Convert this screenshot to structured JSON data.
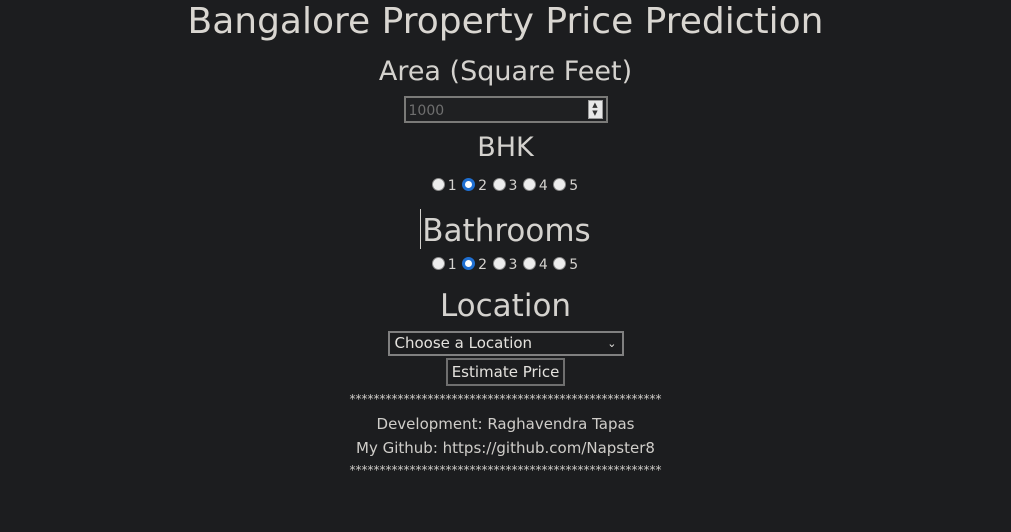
{
  "page": {
    "title": "Bangalore Property Price Prediction"
  },
  "area": {
    "heading": "Area (Square Feet)",
    "placeholder": "1000",
    "spinner_up": "▲",
    "spinner_down": "▼"
  },
  "bhk": {
    "heading": "BHK",
    "options": [
      "1",
      "2",
      "3",
      "4",
      "5"
    ],
    "selected": "2"
  },
  "bathrooms": {
    "heading": "Bathrooms",
    "options": [
      "1",
      "2",
      "3",
      "4",
      "5"
    ],
    "selected": "2"
  },
  "location": {
    "heading": "Location",
    "selected_label": "Choose a Location",
    "chevron": "⌄"
  },
  "actions": {
    "estimate_label": "Estimate Price"
  },
  "footer": {
    "separator": "****************************************************",
    "development": "Development: Raghavendra Tapas",
    "github": "My Github: https://github.com/Napster8"
  }
}
